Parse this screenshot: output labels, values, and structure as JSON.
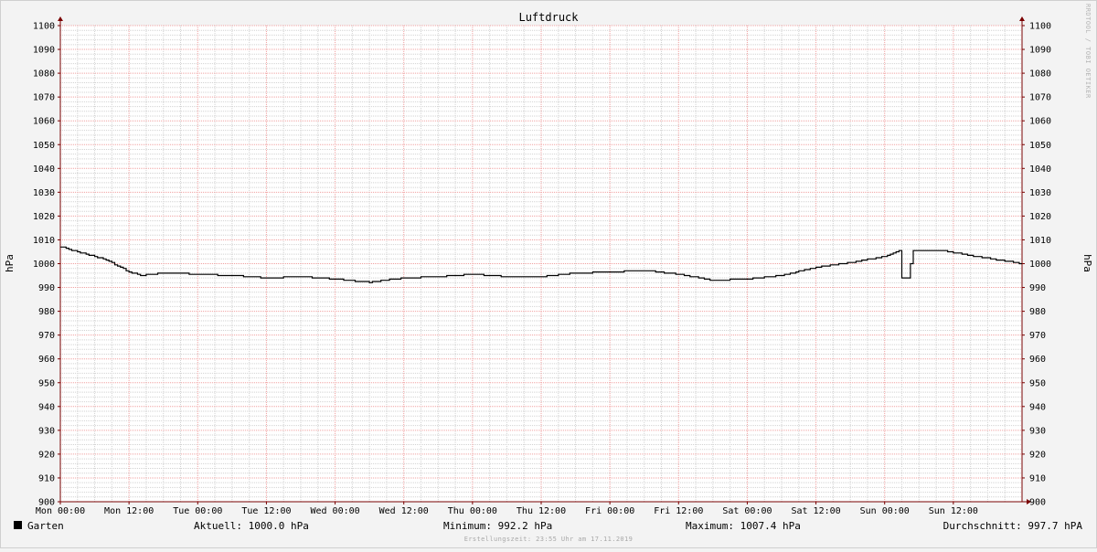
{
  "chart_data": {
    "type": "line",
    "title": "Luftdruck",
    "ylabel": "hPa",
    "ylim": [
      900,
      1100
    ],
    "y_ticks": [
      900,
      910,
      920,
      930,
      940,
      950,
      960,
      970,
      980,
      990,
      1000,
      1010,
      1020,
      1030,
      1040,
      1050,
      1060,
      1070,
      1080,
      1090,
      1100
    ],
    "x_tick_labels": [
      "Mon 00:00",
      "Mon 12:00",
      "Tue 00:00",
      "Tue 12:00",
      "Wed 00:00",
      "Wed 12:00",
      "Thu 00:00",
      "Thu 12:00",
      "Fri 00:00",
      "Fri 12:00",
      "Sat 00:00",
      "Sat 12:00",
      "Sun 00:00",
      "Sun 12:00"
    ],
    "xlim_hours": [
      0,
      168
    ],
    "grid": true,
    "series": [
      {
        "name": "Garten",
        "color": "#000000",
        "x_hours": [
          0,
          3,
          6,
          8,
          10,
          12,
          14,
          16,
          18,
          20,
          24,
          30,
          36,
          42,
          48,
          54,
          60,
          66,
          72,
          78,
          84,
          90,
          96,
          102,
          108,
          114,
          120,
          126,
          132,
          138,
          144,
          146.5,
          147,
          148,
          149,
          154,
          160,
          168
        ],
        "values": [
          1007.2,
          1005,
          1003,
          1001.5,
          999,
          996.5,
          995,
          995.5,
          996,
          996,
          995.5,
          995,
          994,
          994.5,
          993.5,
          992.2,
          994,
          994.5,
          995.5,
          994.5,
          994.5,
          996,
          996.5,
          997.2,
          995.5,
          993,
          993.5,
          995,
          998.5,
          1000.5,
          1003,
          1005.5,
          994,
          994,
          1005.5,
          1005.5,
          1003,
          1000
        ]
      }
    ]
  },
  "legend": {
    "series_name": "Garten",
    "swatch_color": "#000000"
  },
  "stats": {
    "current": "Aktuell: 1000.0 hPa",
    "minimum": "Minimum: 992.2 hPa",
    "maximum": "Maximum: 1007.4 hPa",
    "average": "Durchschnitt: 997.7 hPA"
  },
  "watermark": "RRDTOOL / TOBI OETIKER",
  "footer": "Erstellungszeit: 23:55 Uhr am 17.11.2019",
  "colors": {
    "background": "#f3f3f3",
    "canvas": "#ffffff",
    "major_grid": "#f0a0a0",
    "minor_grid": "#d2d2d2",
    "axis": "#7a0000",
    "line": "#000000"
  }
}
